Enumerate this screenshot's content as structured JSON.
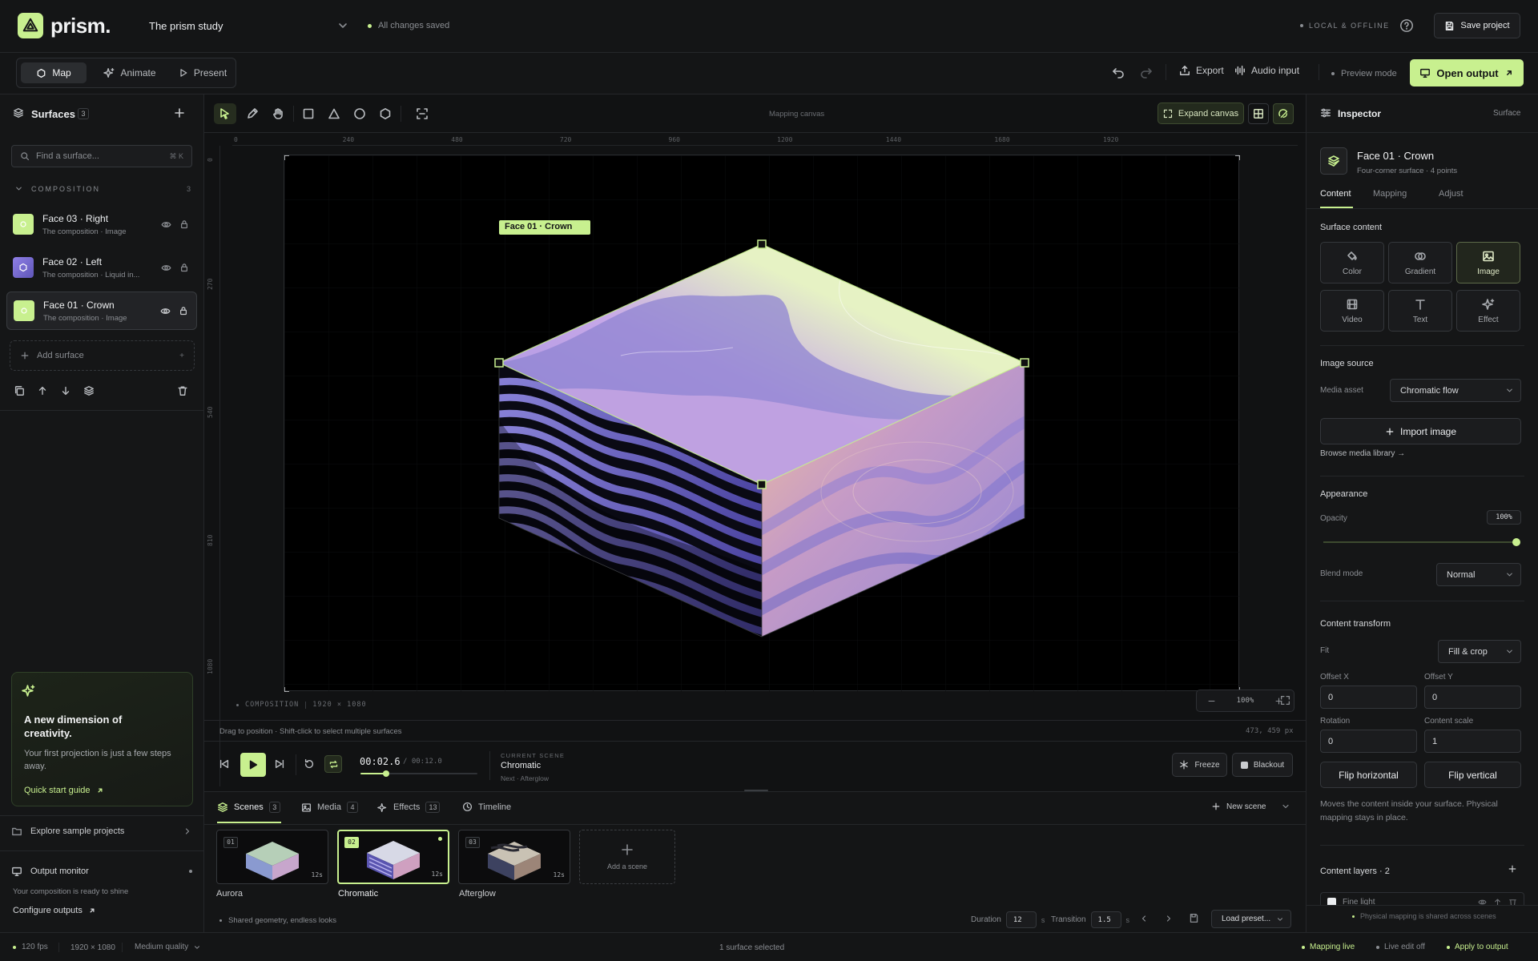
{
  "app": {
    "name": "prism.",
    "project": "The prism study",
    "save_status": "All changes saved",
    "mode_status": "LOCAL & OFFLINE",
    "save_button": "Save project"
  },
  "modes": {
    "items": [
      "Map",
      "Animate",
      "Present"
    ],
    "active": "Map"
  },
  "actions": {
    "export": "Export",
    "audio": "Audio input",
    "preview": "Preview mode",
    "open_output": "Open output"
  },
  "surfaces": {
    "title": "Surfaces",
    "count": "3",
    "search_placeholder": "Find a surface...",
    "search_shortcut": "⌘ K",
    "group": "COMPOSITION",
    "group_count": "3",
    "items": [
      {
        "name": "Face 03 · Right",
        "sub": "The composition · Image"
      },
      {
        "name": "Face 02 · Left",
        "sub": "The composition · Liquid in..."
      },
      {
        "name": "Face 01 · Crown",
        "sub": "The composition · Image"
      }
    ],
    "add": "Add surface"
  },
  "promo": {
    "title": "A new dimension of creativity.",
    "body": "Your first projection is just a few steps away.",
    "link": "Quick start guide"
  },
  "explore": "Explore sample projects",
  "monitor": {
    "title": "Output monitor",
    "status": "Your composition is ready to shine",
    "link": "Configure outputs"
  },
  "canvas": {
    "label": "Mapping canvas",
    "expand": "Expand canvas",
    "ruler_x": [
      "0",
      "240",
      "480",
      "720",
      "960",
      "1200",
      "1440",
      "1680",
      "1920"
    ],
    "ruler_y": [
      "0",
      "270",
      "540",
      "810",
      "1080"
    ],
    "selection_label": "Face 01 · Crown",
    "composition_label": "COMPOSITION",
    "composition_size": "1920 × 1080",
    "zoom": "100%",
    "hint": "Drag to position · Shift-click to select multiple surfaces",
    "cursor": "473, 459 px"
  },
  "transport": {
    "time": "00:02.6",
    "total": "/ 00:12.0",
    "progress": 0.22,
    "scene_label": "CURRENT SCENE",
    "scene": "Chromatic",
    "next": "Next · Afterglow",
    "freeze": "Freeze",
    "blackout": "Blackout"
  },
  "bottom_tabs": [
    {
      "label": "Scenes",
      "count": "3"
    },
    {
      "label": "Media",
      "count": "4"
    },
    {
      "label": "Effects",
      "count": "13"
    },
    {
      "label": "Timeline",
      "count": ""
    }
  ],
  "new_scene": "New scene",
  "scenes": [
    {
      "num": "01",
      "name": "Aurora",
      "dur": "12s"
    },
    {
      "num": "02",
      "name": "Chromatic",
      "dur": "12s"
    },
    {
      "num": "03",
      "name": "Afterglow",
      "dur": "12s"
    }
  ],
  "add_scene": "Add a scene",
  "scene_footer": {
    "note": "Shared geometry, endless looks",
    "duration_label": "Duration",
    "duration": "12",
    "unit": "s",
    "transition_label": "Transition",
    "transition": "1.5",
    "preset": "Load preset..."
  },
  "inspector": {
    "title": "Inspector",
    "kind": "Surface",
    "surface_name": "Face 01 · Crown",
    "surface_sub": "Four-corner surface · 4 points",
    "tabs": [
      "Content",
      "Mapping",
      "Adjust"
    ],
    "content_title": "Surface content",
    "content_types": [
      "Color",
      "Gradient",
      "Image",
      "Video",
      "Text",
      "Effect"
    ],
    "image_source": "Image source",
    "media_asset_label": "Media asset",
    "media_asset": "Chromatic flow",
    "import": "Import image",
    "browse": "Browse media library →",
    "appearance": "Appearance",
    "opacity_label": "Opacity",
    "opacity": "100%",
    "opacity_value": 1.0,
    "blend_label": "Blend mode",
    "blend": "Normal",
    "transform": "Content transform",
    "fit_label": "Fit",
    "fit": "Fill & crop",
    "offset_x_label": "Offset X",
    "offset_x": "0",
    "offset_y_label": "Offset Y",
    "offset_y": "0",
    "rotation_label": "Rotation",
    "rotation": "0",
    "scale_label": "Content scale",
    "scale": "1",
    "flip_h": "Flip horizontal",
    "flip_v": "Flip vertical",
    "transform_note": "Moves the content inside your surface. Physical mapping stays in place.",
    "layers": "Content layers · 2",
    "layer1": "Fine light",
    "footer_note": "Physical mapping is shared across scenes"
  },
  "status": {
    "fps": "120 fps",
    "res": "1920 × 1080",
    "quality": "Medium quality",
    "selection": "1 surface selected",
    "live": "Mapping live",
    "live_edit": "Live edit off",
    "apply": "Apply to output"
  },
  "colors": {
    "accent": "#c8f08f",
    "bg": "#141516",
    "panel": "#161718"
  }
}
